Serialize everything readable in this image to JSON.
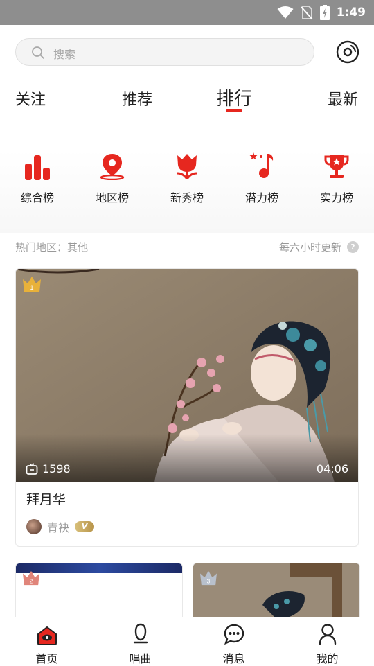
{
  "status_bar": {
    "time": "1:49",
    "icons": [
      "wifi-icon",
      "no-sim-icon",
      "battery-charging-icon"
    ]
  },
  "search": {
    "placeholder": "搜索"
  },
  "header_icon": "disc-icon",
  "tabs": [
    {
      "label": "关注",
      "active": false
    },
    {
      "label": "推荐",
      "active": false
    },
    {
      "label": "排行",
      "active": true
    },
    {
      "label": "最新",
      "active": false
    }
  ],
  "categories": [
    {
      "label": "综合榜",
      "icon": "bar-chart-icon"
    },
    {
      "label": "地区榜",
      "icon": "location-pin-icon"
    },
    {
      "label": "新秀榜",
      "icon": "tulip-icon"
    },
    {
      "label": "潜力榜",
      "icon": "music-note-star-icon"
    },
    {
      "label": "实力榜",
      "icon": "trophy-icon"
    }
  ],
  "region_line": {
    "label": "热门地区：其他",
    "refresh": "每六小时更新",
    "help": "?"
  },
  "featured": {
    "rank": "1",
    "plays": "1598",
    "duration": "04:06",
    "title": "拜月华",
    "author": "青袂",
    "badge": "V"
  },
  "next_cards": [
    {
      "rank": "2"
    },
    {
      "rank": "3"
    }
  ],
  "bottom_nav": [
    {
      "label": "首页",
      "icon": "home-icon",
      "active": true
    },
    {
      "label": "唱曲",
      "icon": "microphone-icon",
      "active": false
    },
    {
      "label": "消息",
      "icon": "chat-bubble-icon",
      "active": false
    },
    {
      "label": "我的",
      "icon": "user-icon",
      "active": false
    }
  ],
  "colors": {
    "accent": "#e6271f",
    "gold": "#e8b13a",
    "muted": "#999999"
  }
}
